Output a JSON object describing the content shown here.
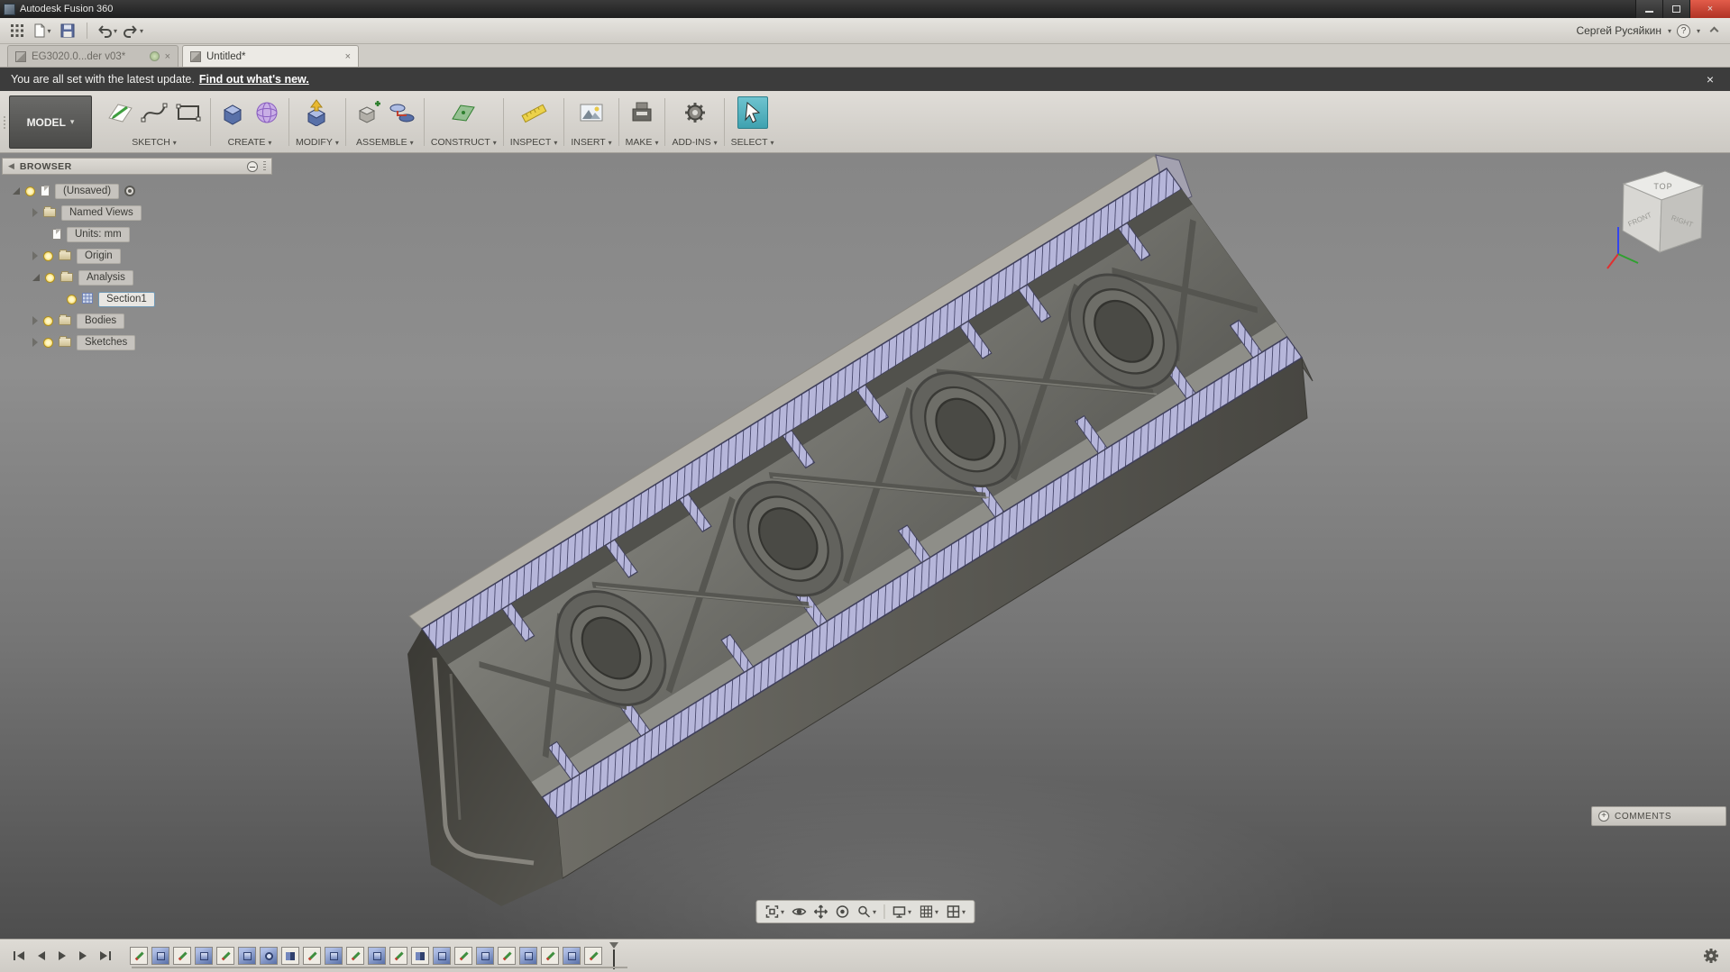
{
  "window": {
    "title": "Autodesk Fusion 360"
  },
  "toolbar": {
    "user": "Сергей Русяйкин"
  },
  "tabs": {
    "inactive": {
      "label": "EG3020.0...der v03*"
    },
    "active": {
      "label": "Untitled*"
    }
  },
  "notification": {
    "message": "You are all set with the latest update.",
    "link": "Find out what's new."
  },
  "ribbon": {
    "workspace": "MODEL",
    "groups": [
      {
        "label": "SKETCH"
      },
      {
        "label": "CREATE"
      },
      {
        "label": "MODIFY"
      },
      {
        "label": "ASSEMBLE"
      },
      {
        "label": "CONSTRUCT"
      },
      {
        "label": "INSPECT"
      },
      {
        "label": "INSERT"
      },
      {
        "label": "MAKE"
      },
      {
        "label": "ADD-INS"
      },
      {
        "label": "SELECT"
      }
    ]
  },
  "browser": {
    "title": "BROWSER",
    "items": [
      {
        "label": "(Unsaved)"
      },
      {
        "label": "Named Views"
      },
      {
        "label": "Units: mm"
      },
      {
        "label": "Origin"
      },
      {
        "label": "Analysis"
      },
      {
        "label": "Section1"
      },
      {
        "label": "Bodies"
      },
      {
        "label": "Sketches"
      }
    ]
  },
  "viewcube": {
    "top": "TOP",
    "front": "FRONT",
    "right": "RIGHT"
  },
  "comments": {
    "label": "COMMENTS"
  },
  "timeline": {
    "features": [
      {
        "type": "sketch"
      },
      {
        "type": "extrude"
      },
      {
        "type": "sketch"
      },
      {
        "type": "extrude"
      },
      {
        "type": "sketch"
      },
      {
        "type": "extrude"
      },
      {
        "type": "revolve"
      },
      {
        "type": "mirror"
      },
      {
        "type": "sketch"
      },
      {
        "type": "extrude"
      },
      {
        "type": "sketch"
      },
      {
        "type": "extrude"
      },
      {
        "type": "sketch"
      },
      {
        "type": "mirror"
      },
      {
        "type": "extrude"
      },
      {
        "type": "sketch"
      },
      {
        "type": "extrude"
      },
      {
        "type": "sketch"
      },
      {
        "type": "extrude"
      },
      {
        "type": "sketch"
      },
      {
        "type": "extrude"
      },
      {
        "type": "sketch"
      }
    ]
  },
  "colors": {
    "hatch_fill": "#b6b6da",
    "hatch_line": "#46466a",
    "select_highlight": "#3fa2b0",
    "close_button": "#c0392b"
  }
}
